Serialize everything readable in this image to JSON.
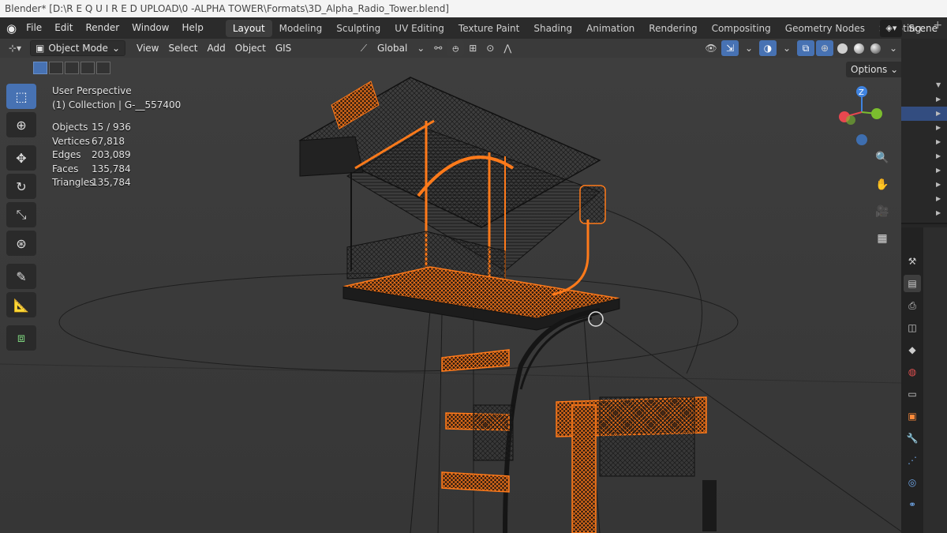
{
  "window": {
    "title": "Blender* [D:\\R E Q U I R E D   UPLOAD\\0 -ALPHA TOWER\\Formats\\3D_Alpha_Radio_Tower.blend]"
  },
  "menu": {
    "items": [
      "File",
      "Edit",
      "Render",
      "Window",
      "Help"
    ]
  },
  "workspaces": {
    "tabs": [
      "Layout",
      "Modeling",
      "Sculpting",
      "UV Editing",
      "Texture Paint",
      "Shading",
      "Animation",
      "Rendering",
      "Compositing",
      "Geometry Nodes",
      "Scripting"
    ],
    "active": "Layout",
    "add": "+"
  },
  "scene": {
    "label": "Scene"
  },
  "viewport_header": {
    "mode": "Object Mode",
    "menus": [
      "View",
      "Select",
      "Add",
      "Object",
      "GIS"
    ],
    "orientation": "Global",
    "options": "Options"
  },
  "overlay": {
    "view_name": "User Perspective",
    "collection": "(1) Collection | G-__557400",
    "stats": [
      {
        "label": "Objects",
        "value": "15 / 936"
      },
      {
        "label": "Vertices",
        "value": "67,818"
      },
      {
        "label": "Edges",
        "value": "203,089"
      },
      {
        "label": "Faces",
        "value": "135,784"
      },
      {
        "label": "Triangles",
        "value": "135,784"
      }
    ]
  },
  "gizmo": {
    "z_label": "Z"
  },
  "colors": {
    "selection_orange": "#ff7a1a",
    "active_blue": "#4772b3",
    "axis_x": "#e8474f",
    "axis_y": "#7bbd2e",
    "axis_z": "#3f83e0"
  },
  "icons": {
    "toolbar": [
      "select-box-icon",
      "cursor-icon",
      "move-icon",
      "rotate-icon",
      "scale-icon",
      "transform-icon",
      "annotate-icon",
      "measure-icon",
      "add-cube-icon"
    ],
    "nav": [
      "zoom-icon",
      "pan-hand-icon",
      "camera-icon",
      "grid-toggle-icon"
    ]
  }
}
